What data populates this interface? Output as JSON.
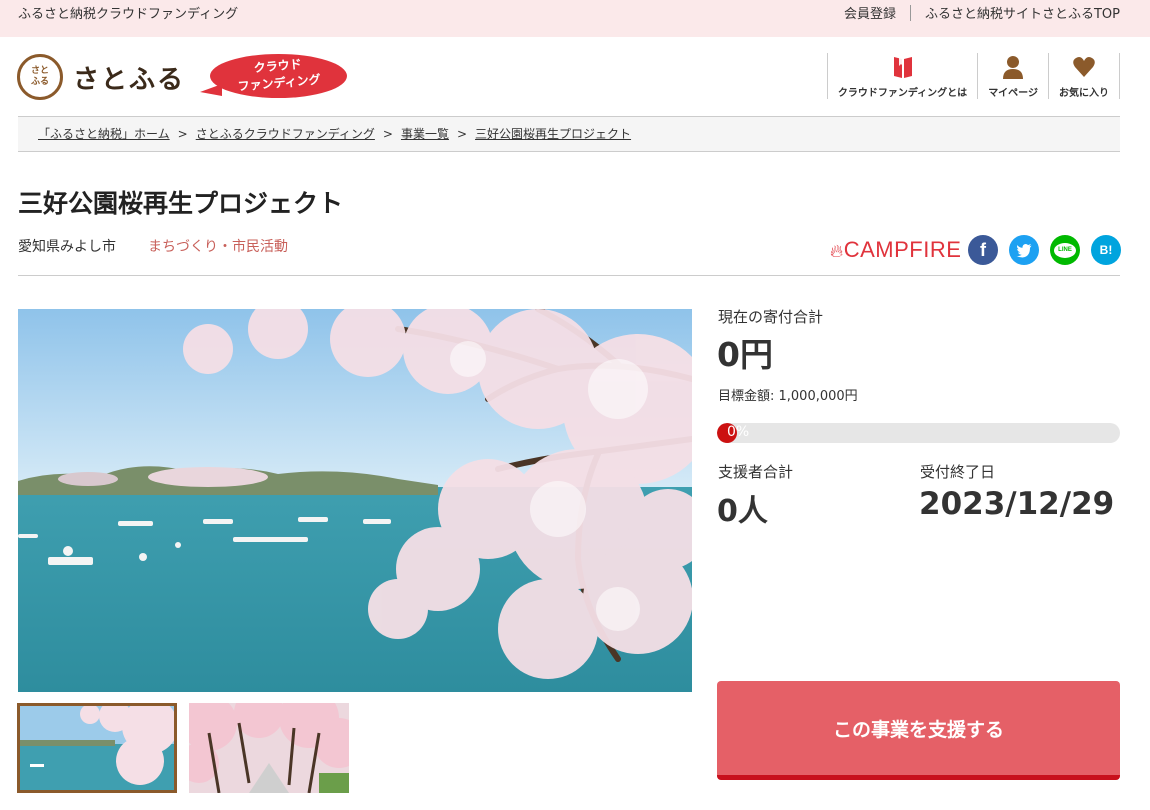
{
  "topbar": {
    "tagline": "ふるさと納税クラウドファンディング",
    "member_link": "会員登録",
    "site_link": "ふるさと納税サイトさとふるTOP"
  },
  "header": {
    "logo_mark": "さとふる",
    "logo_text": "さとふる",
    "cf_badge_line1": "クラウド",
    "cf_badge_line2": "ファンディング",
    "nav": [
      {
        "label": "クラウドファンディングとは",
        "icon": "book-icon"
      },
      {
        "label": "マイページ",
        "icon": "user-icon"
      },
      {
        "label": "お気に入り",
        "icon": "heart-icon"
      }
    ]
  },
  "breadcrumb": [
    "「ふるさと納税」ホーム",
    "さとふるクラウドファンディング",
    "事業一覧",
    "三好公園桜再生プロジェクト"
  ],
  "breadcrumb_sep": ">",
  "project": {
    "title": "三好公園桜再生プロジェクト",
    "region": "愛知県みよし市",
    "category": "まちづくり・市民活動"
  },
  "campfire_logo": "CAMPFIRE",
  "social": [
    {
      "name": "facebook-icon",
      "glyph": "f",
      "color": "#3b5998"
    },
    {
      "name": "twitter-icon",
      "glyph": "t",
      "color": "#1da1f2"
    },
    {
      "name": "line-icon",
      "glyph": "LINE",
      "color": "#00b900"
    },
    {
      "name": "hatena-icon",
      "glyph": "B!",
      "color": "#00a4de"
    }
  ],
  "stats": {
    "total_label": "現在の寄付合計",
    "total_value": "0円",
    "goal_label": "目標金額: 1,000,000円",
    "progress_text": "0%",
    "progress_fraction": 0,
    "supporters_label": "支援者合計",
    "supporters_value": "0人",
    "deadline_label": "受付終了日",
    "deadline_value": "2023/12/29"
  },
  "support_button": "この事業を支援する",
  "colors": {
    "topbar_bg": "#fbe9ea",
    "accent_red": "#e0333c",
    "button_bg": "#e56067",
    "progress_fill": "#cc1111",
    "category_text": "#c8605a"
  }
}
